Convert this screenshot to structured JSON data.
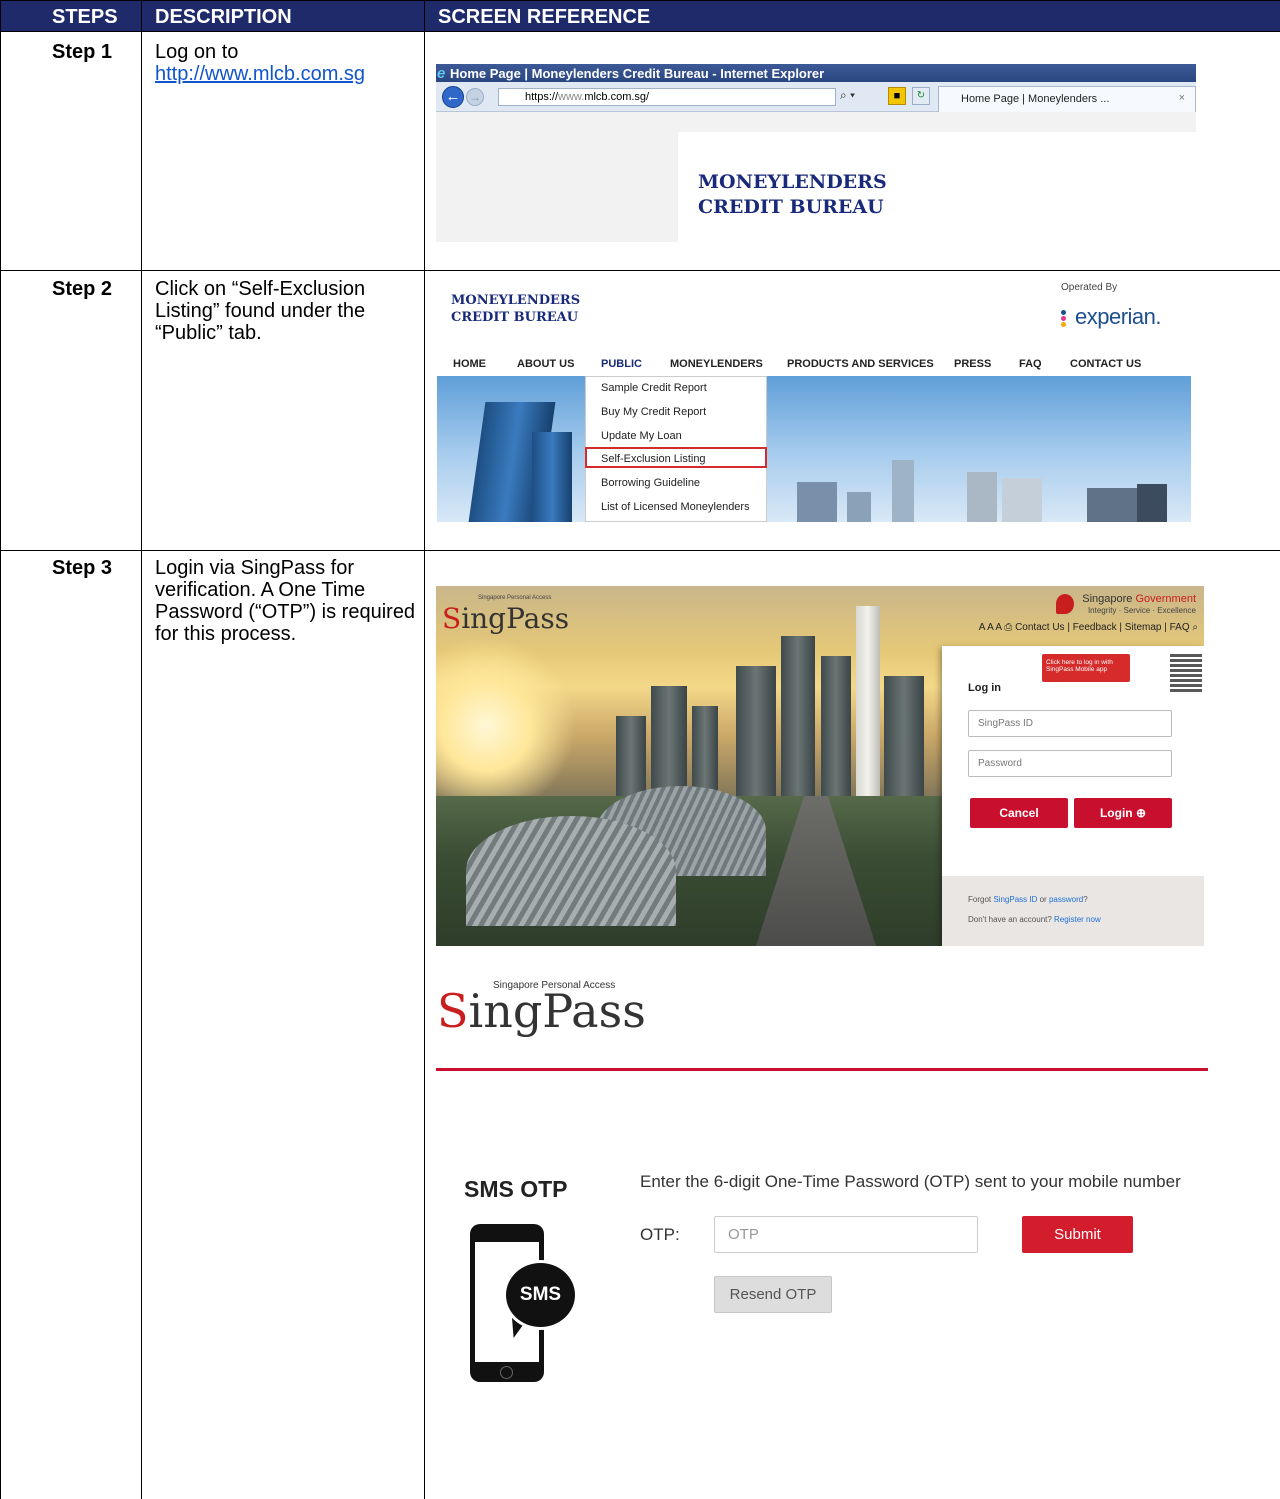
{
  "table": {
    "headers": {
      "steps": "STEPS",
      "description": "DESCRIPTION",
      "screen_reference": "SCREEN REFERENCE"
    },
    "rows": [
      {
        "step": "Step 1",
        "desc_prefix": "Log on to",
        "desc_link": "http://www.mlcb.com.sg"
      },
      {
        "step": "Step 2",
        "desc": "Click on “Self-Exclusion Listing” found under the “Public” tab."
      },
      {
        "step": "Step 3",
        "desc": "Login via SingPass for verification. A One Time Password (“OTP”) is required for this process."
      }
    ]
  },
  "browser": {
    "window_title": "Home Page | Moneylenders Credit Bureau - Internet Explorer",
    "address_scheme": "https://",
    "address_www": "www.",
    "address_rest": "mlcb.com.sg/",
    "tab_label": "Home Page | Moneylenders ...",
    "tab_close": "×",
    "search_glyph": "⌕ ▾",
    "page_logo_line1": "MONEYLENDERS",
    "page_logo_line2": "CREDIT BUREAU"
  },
  "mlcb_site": {
    "logo_line1": "MONEYLENDERS",
    "logo_line2": "CREDIT BUREAU",
    "operated_by": "Operated By",
    "experian": "experian.",
    "nav": [
      "HOME",
      "ABOUT US",
      "PUBLIC",
      "MONEYLENDERS",
      "PRODUCTS AND SERVICES",
      "PRESS",
      "FAQ",
      "CONTACT US"
    ],
    "public_menu": [
      "Sample Credit Report",
      "Buy My Credit Report",
      "Update My Loan",
      "Self-Exclusion Listing",
      "Borrowing Guideline",
      "List of Licensed Moneylenders"
    ],
    "highlighted_item": "Self-Exclusion Listing",
    "highlight_color": "#d52b2b",
    "experian_dot_colors": [
      "#1d4f91",
      "#e63888",
      "#f6a800"
    ]
  },
  "singpass_login": {
    "tagline": "Singapore Personal Access",
    "logo_s": "S",
    "logo_rest": "ingPass",
    "gov_line1_a": "Singapore ",
    "gov_line1_b": "Government",
    "gov_line2": "Integrity · Service · Excellence",
    "top_links": "A  A  A  ⎙  Contact Us | Feedback | Sitemap | FAQ  ⌕",
    "qr_tip": "Click here to log in with SingPass Mobile app",
    "login_heading": "Log in",
    "id_placeholder": "SingPass ID",
    "password_placeholder": "Password",
    "cancel_label": "Cancel",
    "login_label": "Login ⊕",
    "forgot_prefix": "Forgot ",
    "forgot_id": "SingPass ID",
    "forgot_or": " or ",
    "forgot_password": "password",
    "forgot_suffix": "?",
    "no_account": "Don't have an account? ",
    "register": "Register now",
    "brand_red": "#c8102e"
  },
  "sms_otp": {
    "tagline": "Singapore Personal Access",
    "logo_s": "S",
    "logo_rest": "ingPass",
    "title": "SMS OTP",
    "instruction": "Enter the 6-digit One-Time Password (OTP) sent to your mobile number",
    "otp_label": "OTP:",
    "otp_placeholder": "OTP",
    "submit_label": "Submit",
    "resend_label": "Resend OTP",
    "bubble_text": "SMS",
    "accent_color": "#d31c2c"
  }
}
